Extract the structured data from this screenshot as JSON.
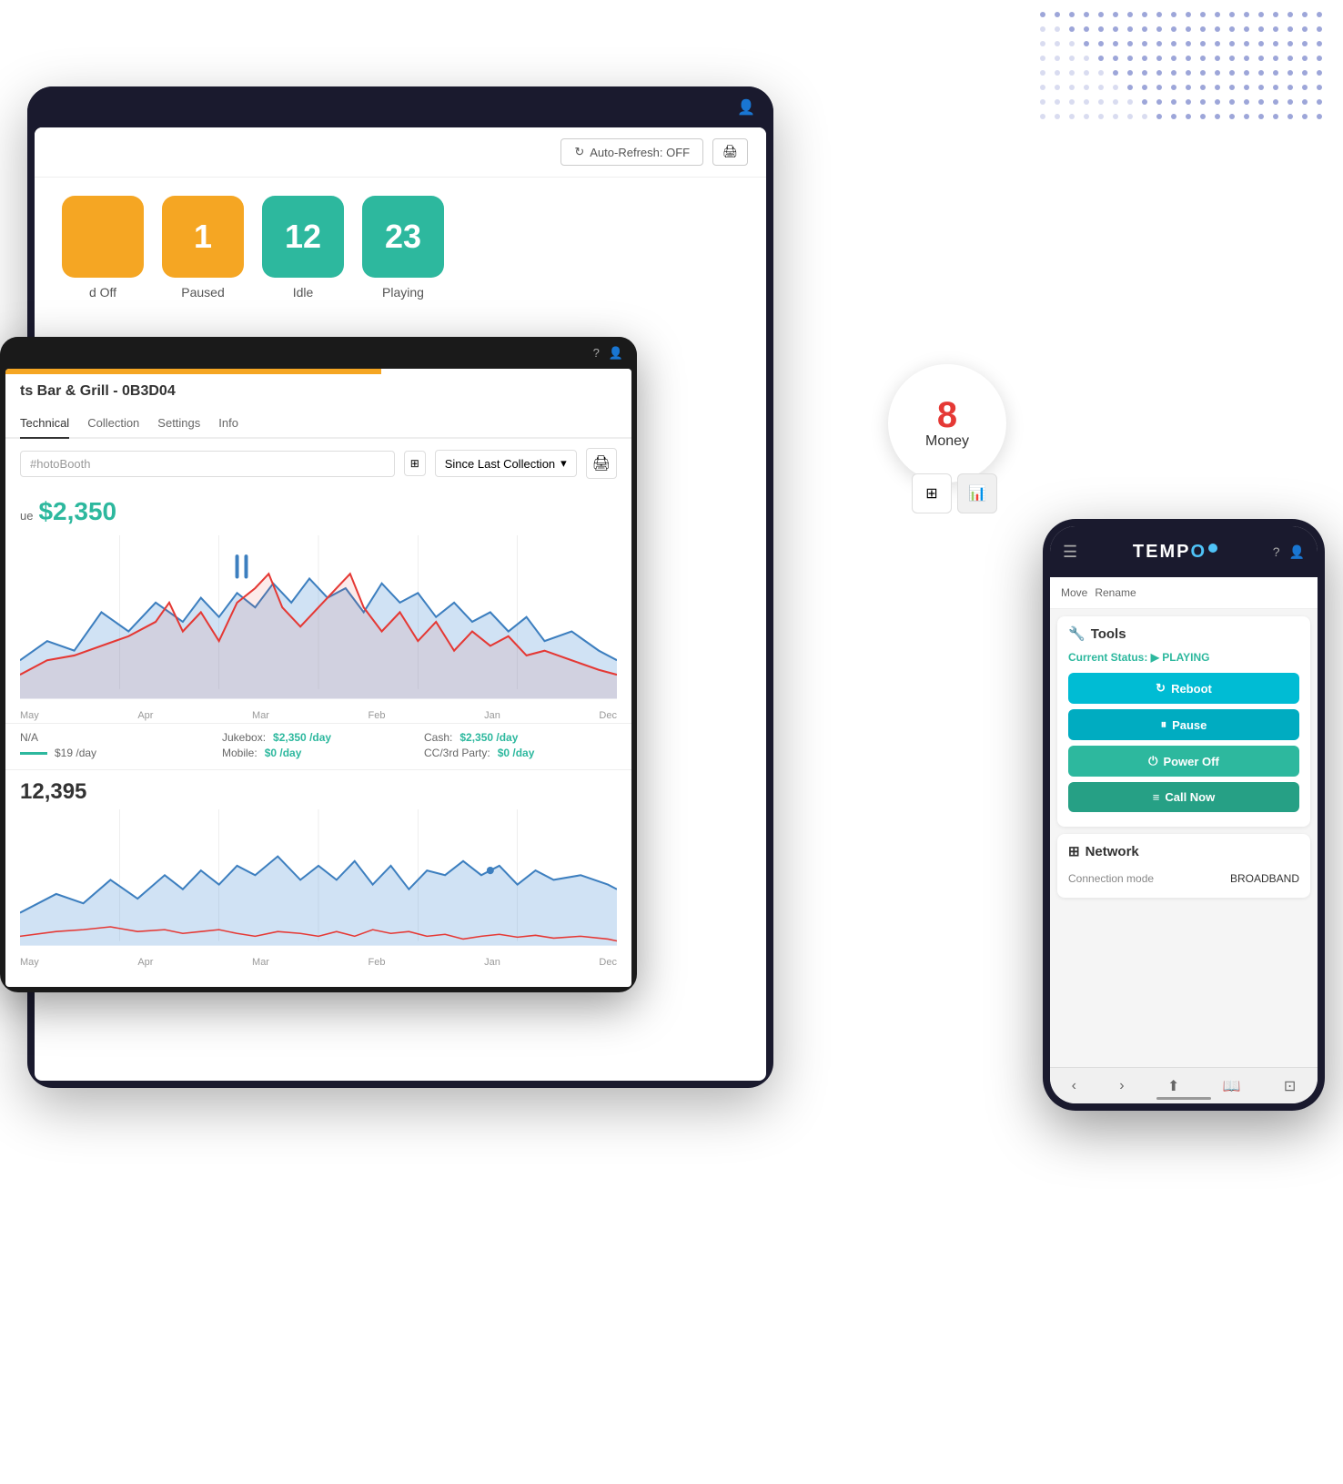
{
  "dots": {
    "rows": 8,
    "cols": 20
  },
  "tablet": {
    "header": {
      "auto_refresh_label": "Auto-Refresh: OFF",
      "print_icon": "🖨"
    },
    "status_cards": [
      {
        "number": "",
        "label": "d Off",
        "color": "orange",
        "partial": true
      },
      {
        "number": "1",
        "label": "Paused",
        "color": "orange"
      },
      {
        "number": "12",
        "label": "Idle",
        "color": "teal"
      },
      {
        "number": "23",
        "label": "Playing",
        "color": "teal"
      }
    ]
  },
  "device": {
    "title": "ts Bar & Grill - 0B3D04",
    "tabs": [
      "Technical",
      "Collection",
      "Settings",
      "Info"
    ],
    "active_tab": "Technical",
    "filter_placeholder": "#hotoBooth",
    "filter_period": "Since Last Collection",
    "revenue_label": "ue",
    "revenue_value": "$2,350",
    "second_revenue_value": "12,395",
    "x_labels_top": [
      "May",
      "Apr",
      "Mar",
      "Feb",
      "Jan",
      "Dec"
    ],
    "x_labels_bottom": [
      "May",
      "Apr",
      "Mar",
      "Feb",
      "Jan",
      "Dec"
    ],
    "stats": {
      "left": {
        "na_label": "N/A",
        "day_value": "$19 /day"
      },
      "right_labels": [
        "Jukebox:",
        "Mobile:",
        "Cash:",
        "CC/3rd Party:"
      ],
      "right_values": [
        "$2,350 /day",
        "$0 /day",
        "$2,350 /day",
        "$0 /day"
      ]
    }
  },
  "money_badge": {
    "number": "8",
    "label": "Money"
  },
  "mobile": {
    "logo": "TEMP",
    "logo_accent": "O",
    "header_icons": [
      "?",
      "👤"
    ],
    "actions": [
      "Move",
      "Rename"
    ],
    "tools_section": {
      "title": "Tools",
      "title_icon": "🔧",
      "current_status_label": "Current Status:",
      "status_value": "PLAYING",
      "buttons": [
        {
          "label": "Reboot",
          "icon": "↻",
          "color": "cyan"
        },
        {
          "label": "Pause",
          "icon": "⏸",
          "color": "cyan2"
        },
        {
          "label": "Power Off",
          "icon": "⏻",
          "color": "green"
        },
        {
          "label": "Call Now",
          "icon": "≡",
          "color": "green2"
        }
      ]
    },
    "network_section": {
      "title": "Network",
      "title_icon": "⊞",
      "rows": [
        {
          "label": "Connection mode",
          "value": "BROADBAND"
        }
      ]
    },
    "bottom_nav": [
      "‹",
      "›",
      "⬆",
      "📖",
      "⊡"
    ]
  }
}
